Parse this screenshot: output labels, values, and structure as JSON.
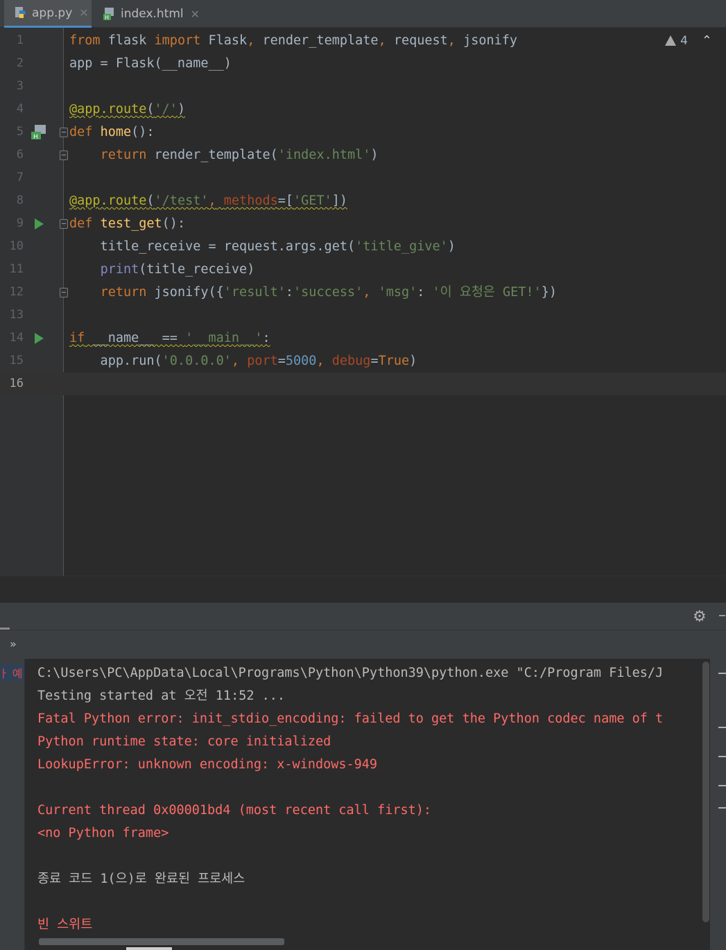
{
  "tabs": [
    {
      "label": "app.py",
      "icon": "python-file-icon",
      "active": true
    },
    {
      "label": "index.html",
      "icon": "html-file-icon",
      "active": false
    }
  ],
  "editor": {
    "warnings_count": "4",
    "line_numbers": [
      "1",
      "2",
      "3",
      "4",
      "5",
      "6",
      "7",
      "8",
      "9",
      "10",
      "11",
      "12",
      "13",
      "14",
      "15",
      "16"
    ],
    "lines": [
      "from flask import Flask, render_template, request, jsonify",
      "app = Flask(__name__)",
      "",
      "@app.route('/')",
      "def home():",
      "    return render_template('index.html')",
      "",
      "@app.route('/test', methods=['GET'])",
      "def test_get():",
      "    title_receive = request.args.get('title_give')",
      "    print(title_receive)",
      "    return jsonify({'result':'success', 'msg': '이 요청은 GET!'})",
      "",
      "if __name__ == '__main__':",
      "    app.run('0.0.0.0', port=5000, debug=True)",
      ""
    ]
  },
  "run_panel": {
    "tree_label": "ㅏ 예",
    "console": [
      {
        "text": "C:\\Users\\PC\\AppData\\Local\\Programs\\Python\\Python39\\python.exe \"C:/Program Files/J",
        "kind": "normal"
      },
      {
        "text": "Testing started at 오전 11:52 ...",
        "kind": "normal"
      },
      {
        "text": "Fatal Python error: init_stdio_encoding: failed to get the Python codec name of t",
        "kind": "err"
      },
      {
        "text": "Python runtime state: core initialized",
        "kind": "err"
      },
      {
        "text": "LookupError: unknown encoding: x-windows-949",
        "kind": "err"
      },
      {
        "text": "",
        "kind": "normal"
      },
      {
        "text": "Current thread 0x00001bd4 (most recent call first):",
        "kind": "err"
      },
      {
        "text": "<no Python frame>",
        "kind": "err"
      },
      {
        "text": "",
        "kind": "normal"
      },
      {
        "text": "종료 코드 1(으)로 완료된 프로세스",
        "kind": "normal"
      },
      {
        "text": "",
        "kind": "normal"
      },
      {
        "text": "빈 스위트",
        "kind": "err"
      }
    ]
  },
  "colors": {
    "background": "#2b2b2b",
    "keyword": "#cc7832",
    "string": "#6a8759",
    "error": "#ff6b68",
    "run_green": "#499c54"
  }
}
